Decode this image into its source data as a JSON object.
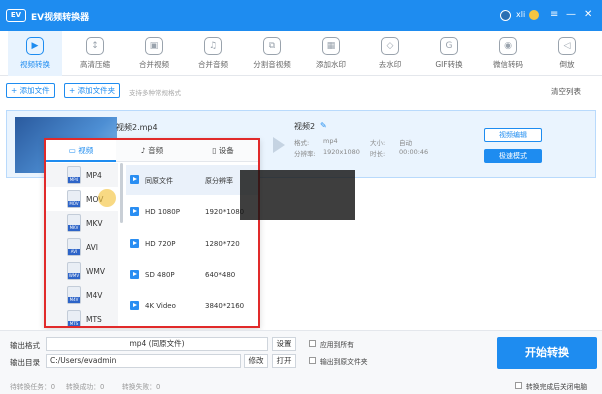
{
  "app": {
    "title": "EV视频转换器",
    "logo_text": "EV",
    "user": "xli"
  },
  "window_controls": {
    "menu": "≡",
    "minimize": "—",
    "close": "✕"
  },
  "toolbar": [
    {
      "label": "视频转换",
      "glyph": "▶",
      "active": true
    },
    {
      "label": "高清压缩",
      "glyph": "↕"
    },
    {
      "label": "合并视频",
      "glyph": "▣"
    },
    {
      "label": "合并音频",
      "glyph": "♫"
    },
    {
      "label": "分割音视频",
      "glyph": "⧉"
    },
    {
      "label": "添加水印",
      "glyph": "▦"
    },
    {
      "label": "去水印",
      "glyph": "◇"
    },
    {
      "label": "GIF转换",
      "glyph": "G"
    },
    {
      "label": "微信转码",
      "glyph": "◉"
    },
    {
      "label": "倒放",
      "glyph": "◁"
    }
  ],
  "actions": {
    "add_file": "+ 添加文件",
    "add_folder": "+ 添加文件夹",
    "hint": "支持多种常规格式",
    "clear_list": "清空列表"
  },
  "file": {
    "name": "视频2.mp4",
    "output_name": "视频2",
    "labels": {
      "format": "格式:",
      "resolution": "分辨率:",
      "size": "大小:",
      "duration": "时长:"
    },
    "format": "mp4",
    "resolution": "1920x1080",
    "size": "自动",
    "duration": "00:00:46",
    "edit_button": "视频编辑",
    "fast_button": "极速模式"
  },
  "popup": {
    "tabs": [
      {
        "label": "视频",
        "glyph": "▭"
      },
      {
        "label": "音频",
        "glyph": "♪"
      },
      {
        "label": "设备",
        "glyph": "▯"
      }
    ],
    "formats": [
      {
        "label": "MP4",
        "band": "MP4"
      },
      {
        "label": "MOV",
        "band": "MOV"
      },
      {
        "label": "MKV",
        "band": "MKV"
      },
      {
        "label": "AVI",
        "band": "AVI"
      },
      {
        "label": "WMV",
        "band": "WMV"
      },
      {
        "label": "M4V",
        "band": "M4V"
      },
      {
        "label": "MTS",
        "band": "MTS"
      }
    ],
    "resolutions": [
      {
        "name": "同原文件",
        "value": "原分辨率"
      },
      {
        "name": "HD 1080P",
        "value": "1920*1080"
      },
      {
        "name": "HD 720P",
        "value": "1280*720"
      },
      {
        "name": "SD 480P",
        "value": "640*480"
      },
      {
        "name": "4K Video",
        "value": "3840*2160"
      }
    ]
  },
  "bottom": {
    "output_format_label": "输出格式",
    "output_format_value": "mp4 (同原文件)",
    "settings_button": "设置",
    "apply_all": "应用到所有",
    "output_dir_label": "输出目录",
    "output_dir_value": "C:/Users/evadmin",
    "modify_button": "修改",
    "open_button": "打开",
    "output_to_source": "输出到原文件夹",
    "start_button": "开始转换",
    "pending": "待转换任务：0",
    "success": "转换成功：0",
    "failed": "转换失败：0",
    "shutdown": "转换完成后关闭电脑"
  }
}
